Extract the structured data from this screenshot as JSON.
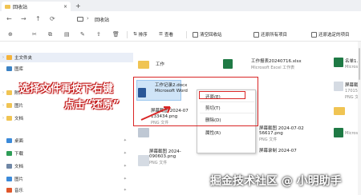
{
  "window": {
    "tab_title": "回收站",
    "close_glyph": "×",
    "add_tab_glyph": "+",
    "address": "回收站",
    "nav": {
      "back": "←",
      "forward": "→",
      "up": "↑",
      "refresh": "⟳",
      "sep": "›"
    }
  },
  "toolbar": {
    "new_glyph": "⊕",
    "cut_glyph": "✂",
    "items": [
      {
        "label": "排序",
        "icon": "sort-icon"
      },
      {
        "label": "查看",
        "icon": "view-icon"
      },
      {
        "label": "清空回收站",
        "icon": "empty-bin-icon"
      },
      {
        "label": "还原所有项目",
        "icon": "restore-all-icon"
      },
      {
        "label": "还原选定的项目",
        "icon": "restore-selected-icon"
      }
    ]
  },
  "sidebar": {
    "items": [
      {
        "label": "主文件夹",
        "icon": "home-icon",
        "color": "#f4b33a"
      },
      {
        "label": "图库",
        "icon": "gallery-icon",
        "color": "#3b82c4"
      },
      {
        "label": "附件",
        "icon": "folder-icon",
        "color": "#f0c453"
      },
      {
        "label": "图片",
        "icon": "folder-icon",
        "color": "#f0c453"
      },
      {
        "label": "文档",
        "icon": "folder-icon",
        "color": "#f0c453"
      },
      {
        "label": "桌面",
        "icon": "desktop-icon",
        "color": "#3b8ad9"
      },
      {
        "label": "下载",
        "icon": "download-icon",
        "color": "#2e9d57"
      },
      {
        "label": "文档",
        "icon": "documents-icon",
        "color": "#6f87a6"
      },
      {
        "label": "图片",
        "icon": "pictures-icon",
        "color": "#3b8ad9"
      },
      {
        "label": "音乐",
        "icon": "music-icon",
        "color": "#e0572b"
      }
    ]
  },
  "files": {
    "folder_label": "工作",
    "docx_name_l1": "工作记录2.docx",
    "docx_name_l2": "Microsoft Word",
    "png1_l1": "屏幕截图 2024-07",
    "png1_l2": "133434.png",
    "png1_sub": "PNG 文件",
    "png2_l1": "屏幕截图 2024-",
    "png2_l2": "090603.png",
    "png2_sub": "PNG 文件",
    "xlsx_name": "工作报表20240716.xlsx",
    "xlsx_sub": "Microsoft Excel 工作表",
    "png3_l1": "屏幕截图 2024-07-02",
    "png3_l2": "56617.png",
    "png3_sub": "PNG 文件",
    "mp4_name": "屏幕录制 2024-07",
    "right1": "名单1.x",
    "right1_sub": "Micros",
    "right2": "屏幕截",
    "right2_sub": "17015",
    "right3": "PNG 文",
    "right4": "Micros"
  },
  "context_menu": {
    "items": [
      "还原(E)",
      "剪切(T)",
      "删除(D)",
      "属性(R)"
    ]
  },
  "annotation": {
    "line1": "选择文件再按下右键",
    "line2": "点击“还原”"
  },
  "watermark": "掘金技术社区 @ 小明助手"
}
